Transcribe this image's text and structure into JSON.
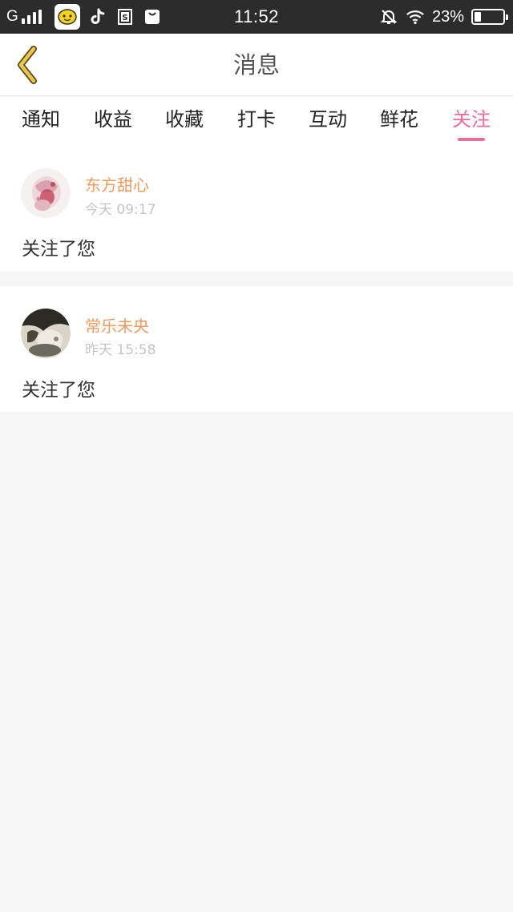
{
  "status_bar": {
    "network": "G",
    "time": "11:52",
    "battery_percent": "23%",
    "battery_level": 0.23,
    "icons": [
      "signal-icon",
      "app-icon",
      "tiktok-icon",
      "s-icon",
      "bag-icon",
      "mute-icon",
      "wifi-icon",
      "battery-icon"
    ]
  },
  "navbar": {
    "title": "消息",
    "back_icon": "chevron-left-icon"
  },
  "tabs": [
    {
      "label": "通知",
      "active": false
    },
    {
      "label": "收益",
      "active": false
    },
    {
      "label": "收藏",
      "active": false
    },
    {
      "label": "打卡",
      "active": false
    },
    {
      "label": "互动",
      "active": false
    },
    {
      "label": "鲜花",
      "active": false
    },
    {
      "label": "关注",
      "active": true
    }
  ],
  "notifications": [
    {
      "username": "东方甜心",
      "time": "今天 09:17",
      "message": "关注了您"
    },
    {
      "username": "常乐未央",
      "time": "昨天 15:58",
      "message": "关注了您"
    }
  ],
  "colors": {
    "accent": "#e86d9b",
    "username": "#ef9b5c",
    "status_bar": "#2c2c2c",
    "back_chevron": "#e8c84a"
  }
}
